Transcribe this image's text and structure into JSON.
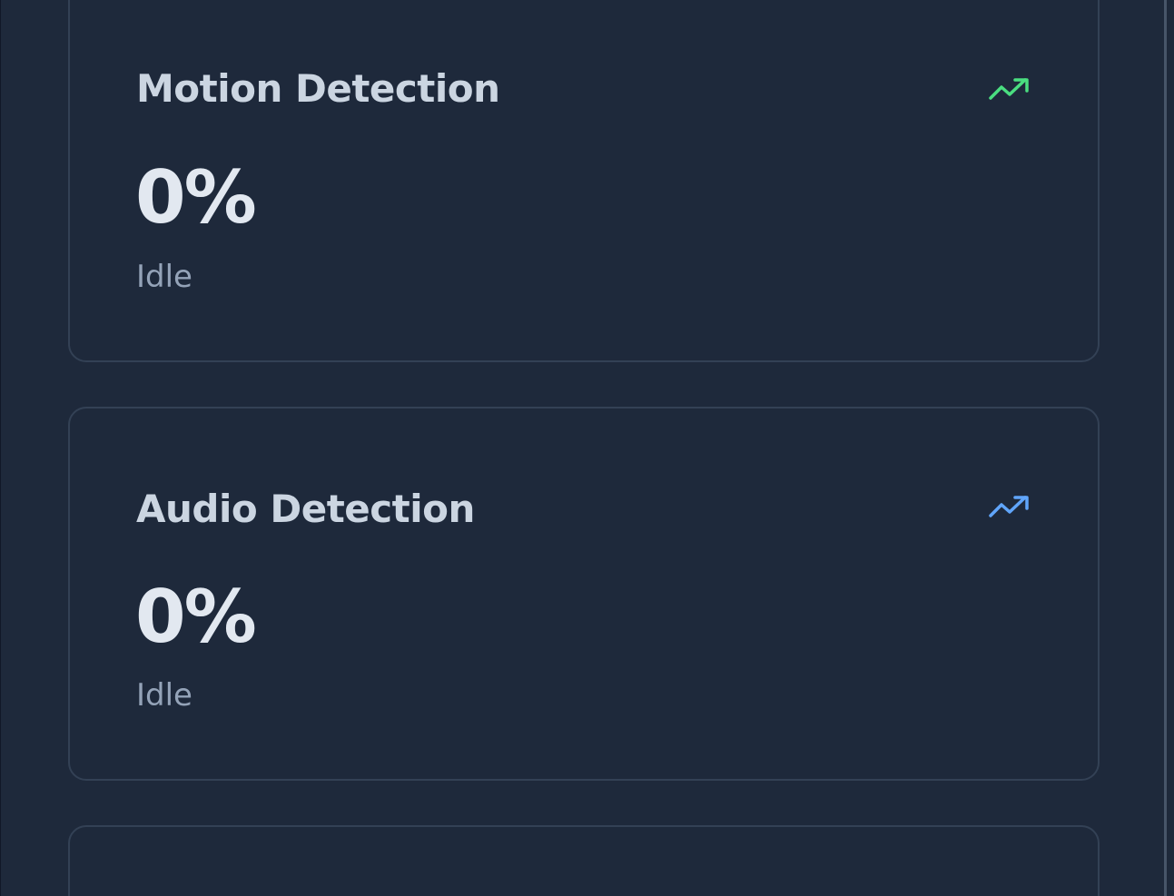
{
  "cards": [
    {
      "title": "Motion Detection",
      "value": "0%",
      "status": "Idle",
      "icon": "trending-up-icon",
      "icon_color": "#4ade80"
    },
    {
      "title": "Audio Detection",
      "value": "0%",
      "status": "Idle",
      "icon": "trending-up-icon",
      "icon_color": "#60a5fa"
    }
  ],
  "colors": {
    "background": "#1e293b",
    "card_border": "#334155",
    "title": "#cbd5e1",
    "value": "#e2e8f0",
    "status": "#94a3b8"
  }
}
